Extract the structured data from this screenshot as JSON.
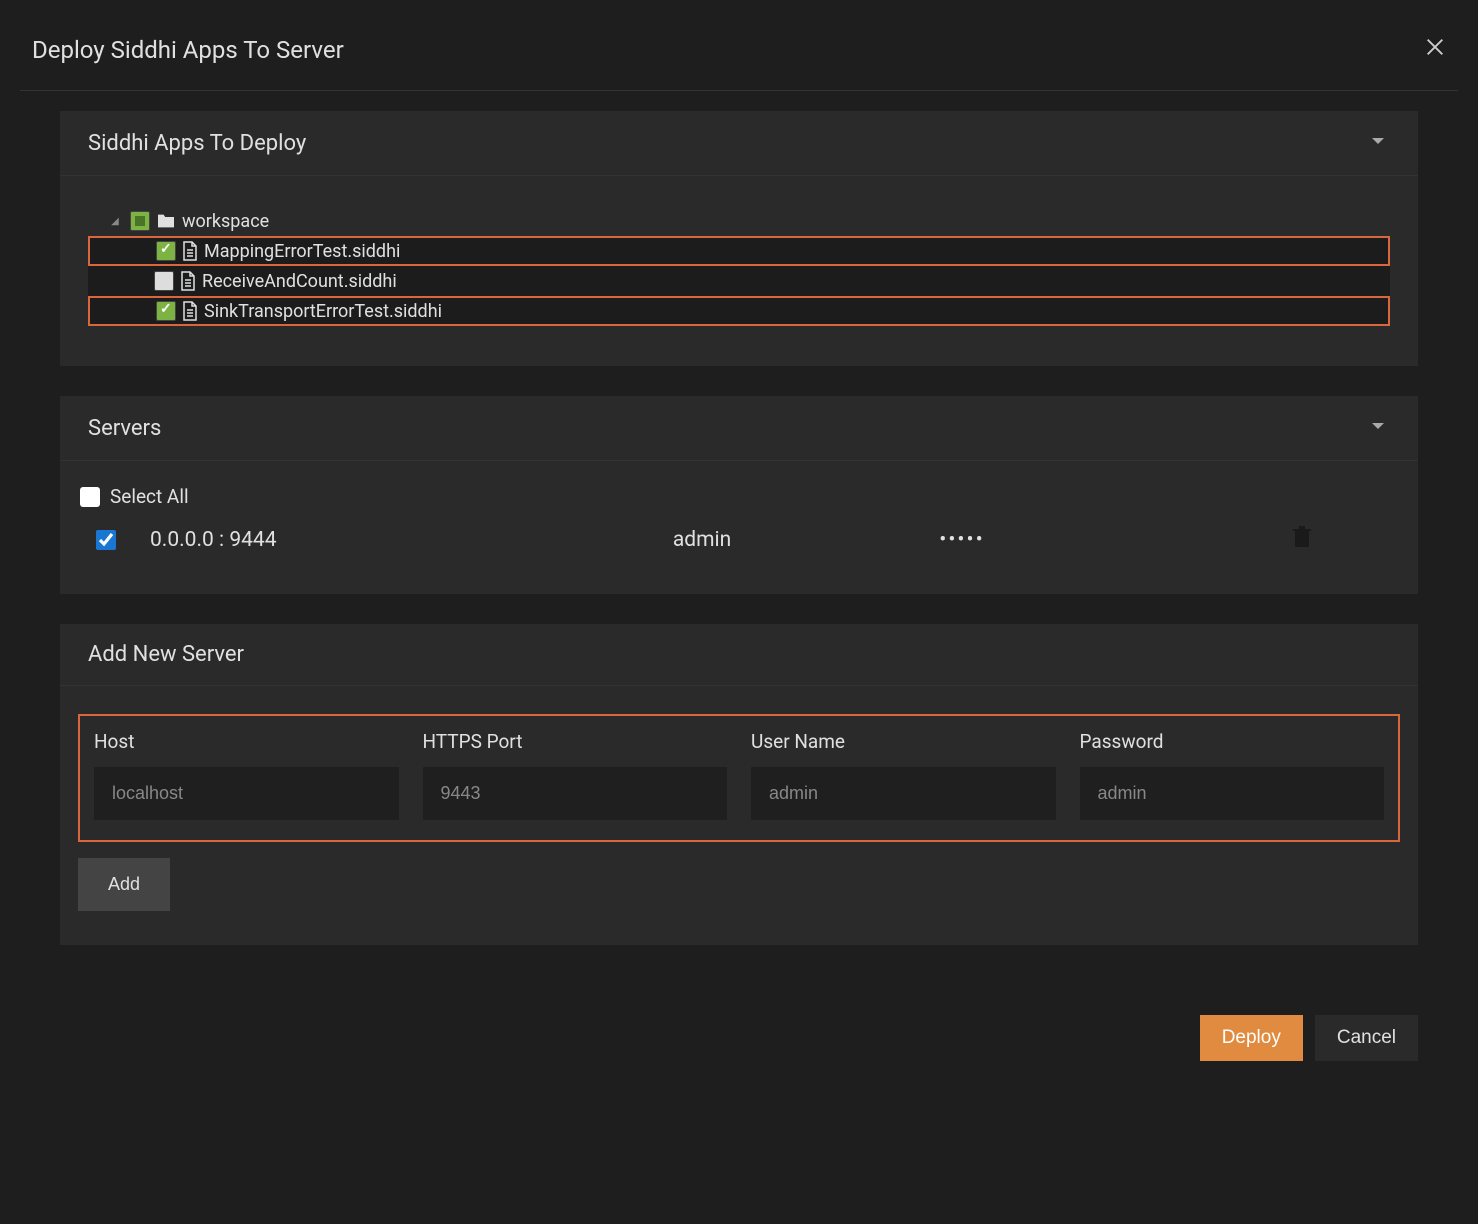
{
  "dialog": {
    "title": "Deploy Siddhi Apps To Server"
  },
  "apps_panel": {
    "title": "Siddhi Apps To Deploy",
    "root_folder": "workspace",
    "files": [
      {
        "name": "MappingErrorTest.siddhi",
        "highlighted": true,
        "checked": true
      },
      {
        "name": "ReceiveAndCount.siddhi",
        "highlighted": false,
        "checked": false
      },
      {
        "name": "SinkTransportErrorTest.siddhi",
        "highlighted": true,
        "checked": true
      }
    ]
  },
  "servers_panel": {
    "title": "Servers",
    "select_all_label": "Select All",
    "rows": [
      {
        "host": "0.0.0.0 : 9444",
        "user": "admin",
        "pass": "•••••",
        "checked": true
      }
    ]
  },
  "add_server_panel": {
    "title": "Add New Server",
    "host_label": "Host",
    "port_label": "HTTPS Port",
    "user_label": "User Name",
    "pass_label": "Password",
    "host_placeholder": "localhost",
    "port_placeholder": "9443",
    "user_placeholder": "admin",
    "pass_placeholder": "admin",
    "add_button": "Add"
  },
  "footer": {
    "deploy": "Deploy",
    "cancel": "Cancel"
  }
}
